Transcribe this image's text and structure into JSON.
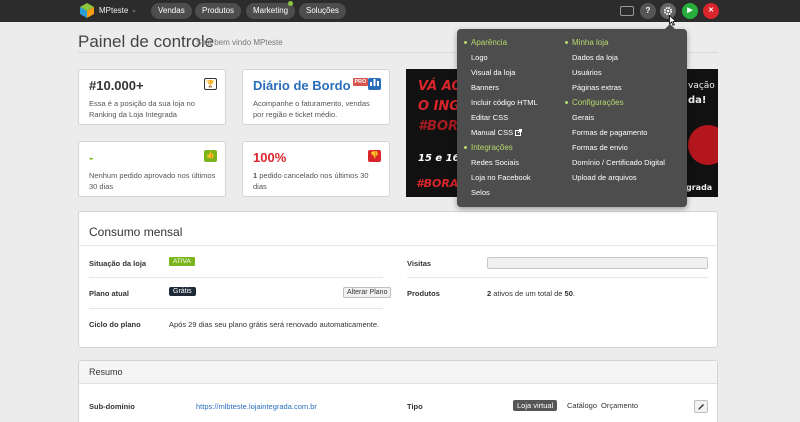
{
  "app": {
    "store_name": "MPteste",
    "nav": [
      "Vendas",
      "Produtos",
      "Marketing",
      "Soluções"
    ],
    "icons": [
      "monitor-icon",
      "help-icon",
      "gear-icon",
      "play-icon",
      "close-icon"
    ],
    "help_glyph": "?",
    "play_glyph": "▶",
    "close_glyph": "✕"
  },
  "header": {
    "title": "Painel de controle",
    "subtitle": "Seja bem vindo MPteste"
  },
  "cards": [
    {
      "title": "#10.000+",
      "text": "Essa é a posição da sua loja no Ranking da Loja Integrada",
      "icon": "trophy-icon",
      "color": "#333333"
    },
    {
      "title": "Diário de Bordo",
      "badge": "PRO",
      "text": "Acompanhe o faturamento, vendas por região e ticket médio.",
      "icon": "bar-chart-icon",
      "color": "#2a6ebb"
    },
    {
      "title": "-",
      "text": "Nenhum pedido aprovado nos últimos 30 dias",
      "icon": "thumbs-up-icon",
      "color": "#7ab51d"
    },
    {
      "title": "100%",
      "text_bold": "1",
      "text": " pedido cancelado nos últimos 30 dias",
      "icon": "thumbs-down-icon",
      "color": "#d9262c"
    }
  ],
  "banner": {
    "lines": [
      "VÁ AO",
      "O INGR",
      "#BORA",
      "15 e 16 de",
      "#BORAVE"
    ],
    "right_lines": [
      "vação",
      "da!",
      "grada"
    ]
  },
  "menu": {
    "col1": [
      {
        "head": "Aparência",
        "items": [
          "Logo",
          "Visual da loja",
          "Banners",
          "Incluir código HTML",
          "Editar CSS",
          "Manual CSS"
        ]
      },
      {
        "head": "Integrações",
        "items": [
          "Redes Sociais",
          "Loja no Facebook",
          "Selos"
        ]
      }
    ],
    "col2": [
      {
        "head": "Minha loja",
        "items": [
          "Dados da loja",
          "Usuários",
          "Páginas extras"
        ]
      },
      {
        "head": "Configurações",
        "items": [
          "Gerais",
          "Formas de pagamento",
          "Formas de envio",
          "Domínio / Certificado Digital",
          "Upload de arquivos"
        ]
      }
    ],
    "external_icon": "external-link-icon"
  },
  "consumo": {
    "title": "Consumo mensal",
    "situacao_label": "Situação da loja",
    "situacao_value": "ATIVA",
    "visitas_label": "Visitas",
    "visitas_fraction": 0,
    "plano_label": "Plano atual",
    "plano_value": "Grátis",
    "alterar_button": "Alterar Plano",
    "produtos_label": "Produtos",
    "produtos_count": "2",
    "produtos_mid": " ativos de um total de ",
    "produtos_total": "50",
    "produtos_end": ".",
    "ciclo_label": "Ciclo do plano",
    "ciclo_value": "Após 29 dias seu plano grátis será renovado automaticamente."
  },
  "resumo": {
    "title": "Resumo",
    "subdominio_label": "Sub-domínio",
    "subdominio_value": "https://mlbteste.lojaintegrada.com.br",
    "tipo_label": "Tipo",
    "tipo_options": [
      "Loja virtual",
      "Catálogo",
      "Orçamento"
    ],
    "tipo_selected": "Loja virtual"
  }
}
